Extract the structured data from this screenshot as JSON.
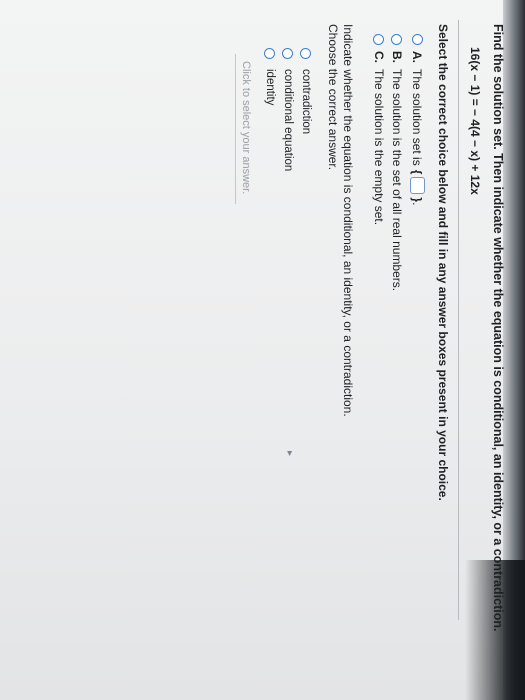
{
  "question": {
    "title": "Find the solution set. Then indicate whether the equation is conditional, an identity, or a contradiction.",
    "equation": "16(x − 1) = − 4(4 − x) + 12x",
    "instructions": "Select the correct choice below and fill in any answer boxes present in your choice."
  },
  "choices": [
    {
      "letter": "A.",
      "text": "The solution set is",
      "brace_open": "{",
      "brace_close": "}",
      "suffix": "."
    },
    {
      "letter": "B.",
      "text": "The solution is the set of all real numbers."
    },
    {
      "letter": "C.",
      "text": "The solution is the empty set."
    }
  ],
  "classification": {
    "prompt": "Indicate whether the equation is conditional, an identity, or a contradiction.",
    "subprompt": "Choose the correct answer.",
    "options": [
      "contradiction",
      "conditional equation",
      "identity"
    ]
  },
  "footer": {
    "hint": "Click to select your answer."
  },
  "colors": {
    "radio_accent": "#3c7fd0",
    "page_bg": "#eeefef"
  }
}
